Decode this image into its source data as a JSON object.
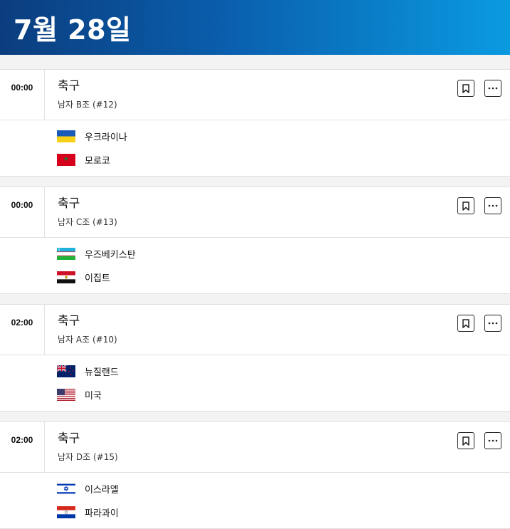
{
  "header": {
    "date_title": "7월 28일"
  },
  "matches": [
    {
      "time": "00:00",
      "sport": "축구",
      "group": "남자 B조 (#12)",
      "teams": [
        {
          "name": "우크라이나",
          "flag": "ukraine-flag-icon"
        },
        {
          "name": "모로코",
          "flag": "morocco-flag-icon"
        }
      ]
    },
    {
      "time": "00:00",
      "sport": "축구",
      "group": "남자 C조 (#13)",
      "teams": [
        {
          "name": "우즈베키스탄",
          "flag": "uzbekistan-flag-icon"
        },
        {
          "name": "이집트",
          "flag": "egypt-flag-icon"
        }
      ]
    },
    {
      "time": "02:00",
      "sport": "축구",
      "group": "남자 A조 (#10)",
      "teams": [
        {
          "name": "뉴질랜드",
          "flag": "new-zealand-flag-icon"
        },
        {
          "name": "미국",
          "flag": "usa-flag-icon"
        }
      ]
    },
    {
      "time": "02:00",
      "sport": "축구",
      "group": "남자 D조 (#15)",
      "teams": [
        {
          "name": "이스라엘",
          "flag": "israel-flag-icon"
        },
        {
          "name": "파라과이",
          "flag": "paraguay-flag-icon"
        }
      ]
    }
  ],
  "icons": {
    "bookmark": "bookmark-icon",
    "more": "more-options-icon"
  }
}
